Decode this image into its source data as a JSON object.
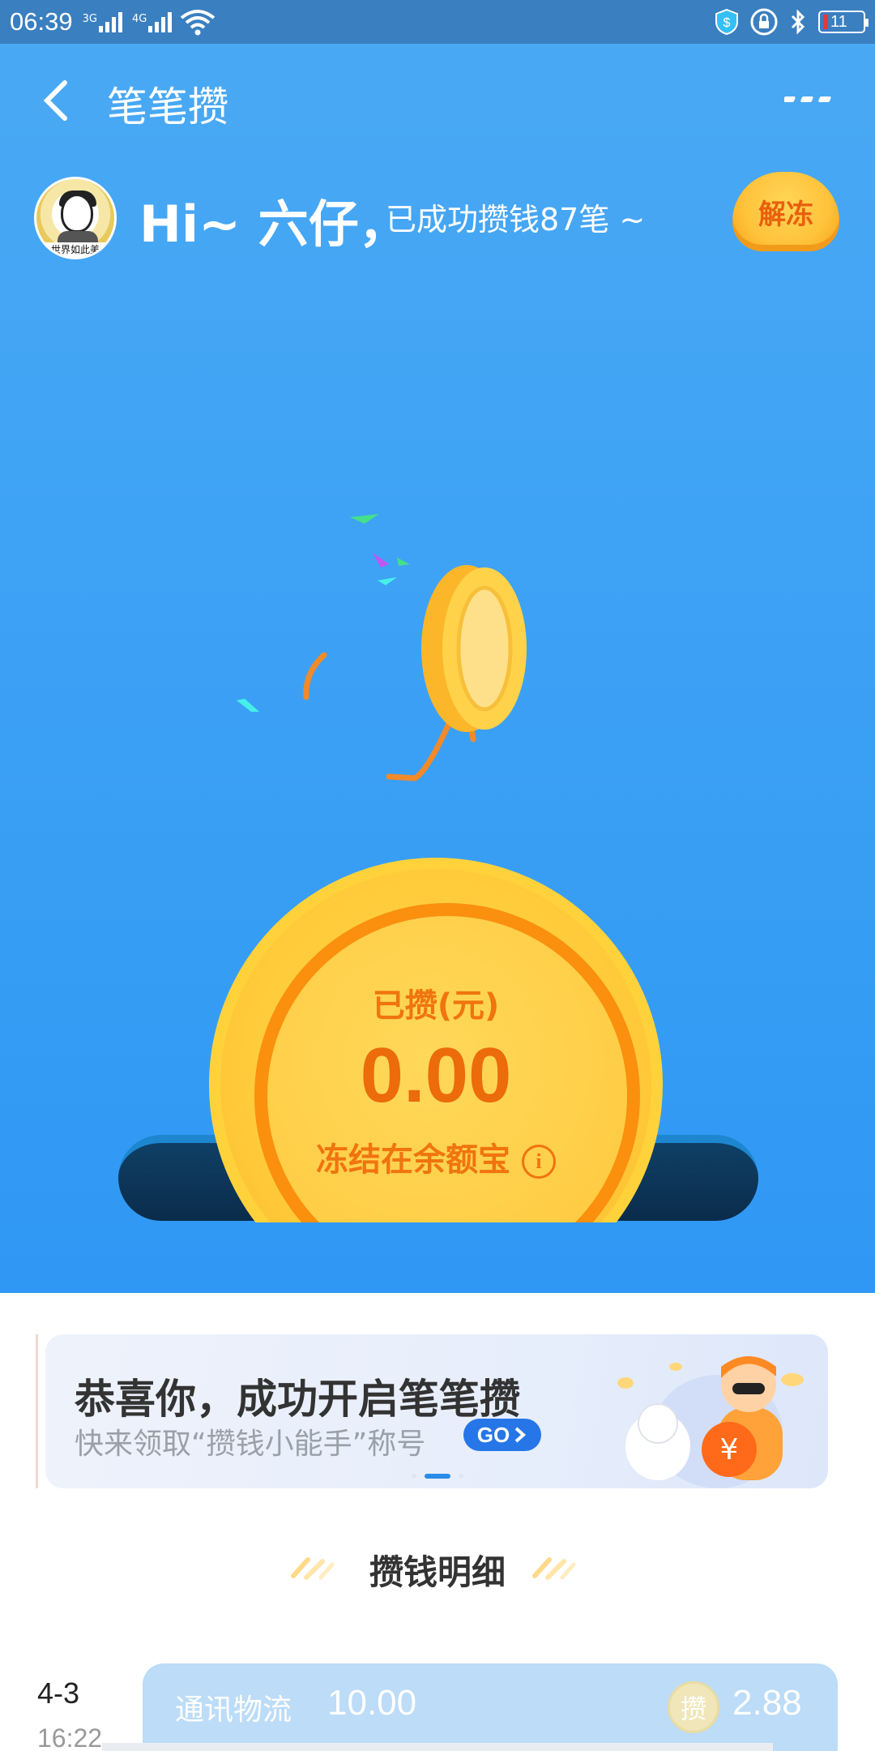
{
  "status_bar": {
    "time": "06:39",
    "net1": "3G",
    "net2": "4G",
    "battery": "11",
    "icons": [
      "signal-icon",
      "wifi-icon",
      "shield-icon",
      "lock-icon",
      "bluetooth-icon",
      "battery-icon"
    ]
  },
  "nav": {
    "title": "笔笔攒",
    "back_icon": "chevron-left-icon",
    "more_icon": "more-icon"
  },
  "greeting": {
    "hi": "Hi~ 六仔，",
    "count_text": "已成功攒钱87笔 ~",
    "unfreeze_label": "解冻",
    "avatar_caption": "世界如此美"
  },
  "piggy": {
    "unit_label": "已攒(元)",
    "amount": "0.00",
    "status": "冻结在余额宝",
    "info_icon": "info-icon"
  },
  "banner": {
    "title": "恭喜你，成功开启笔笔攒",
    "subtitle": "快来领取“攒钱小能手”称号",
    "go_label": "GO",
    "page_count": 3,
    "active_page": 2
  },
  "details": {
    "section_title": "攒钱明细",
    "records": [
      {
        "date": "4-3",
        "time": "16:22",
        "category": "通讯物流",
        "amount": "10.00",
        "badge": "攒",
        "saved": "2.88"
      }
    ]
  },
  "colors": {
    "hero_blue": "#3fa3f5",
    "coin_gold": "#ffcb3a",
    "coin_orange": "#f07410",
    "go_blue": "#2676e8"
  }
}
